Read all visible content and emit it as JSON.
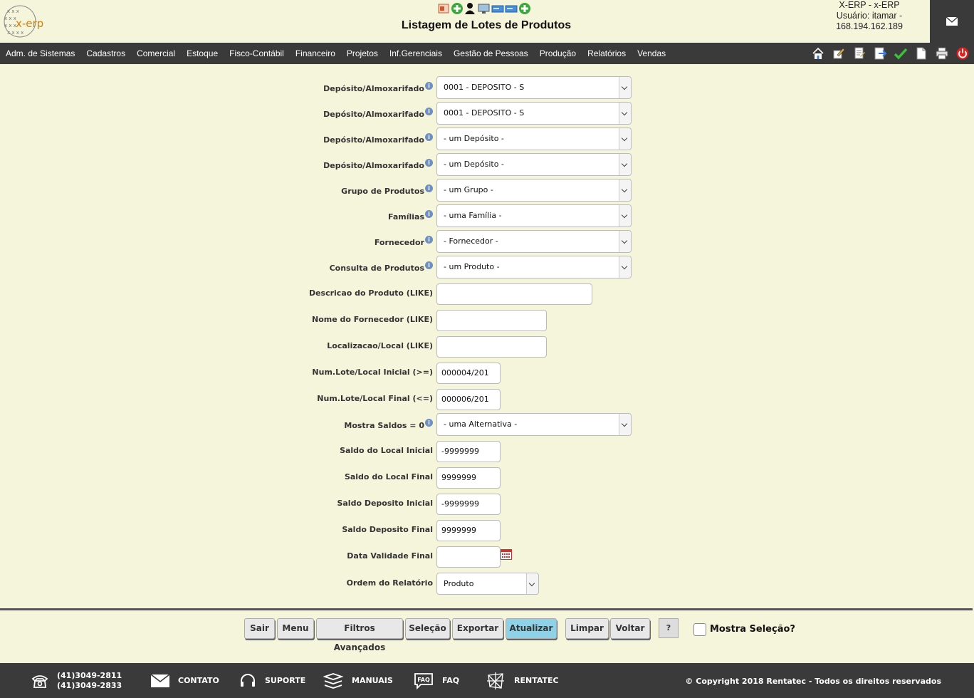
{
  "header": {
    "logo_text": "x-erp",
    "title": "Listagem de Lotes de Produtos",
    "user": {
      "system": "X-ERP - x-ERP",
      "user_line": "Usuário: itamar -",
      "ip": "168.194.162.189"
    },
    "toolbar_icons": [
      "report-icon",
      "add-icon",
      "user-icon",
      "monitor-icon",
      "card-icon",
      "card-icon",
      "add-icon"
    ]
  },
  "nav": {
    "items": [
      "Adm. de Sistemas",
      "Cadastros",
      "Comercial",
      "Estoque",
      "Fisco-Contábil",
      "Financeiro",
      "Projetos",
      "Inf.Gerenciais",
      "Gestão de Pessoas",
      "Produção",
      "Relatórios",
      "Vendas"
    ],
    "icons": [
      "home-icon",
      "edit-icon",
      "notes-icon",
      "export-icon",
      "check-icon",
      "document-icon",
      "print-icon",
      "power-icon"
    ]
  },
  "form": {
    "fields": [
      {
        "label": "Depósito/Almoxarifado",
        "info": "i",
        "value": "0001 - DEPOSITO - S"
      },
      {
        "label": "Depósito/Almoxarifado",
        "info": "i",
        "value": "0001 - DEPOSITO - S"
      },
      {
        "label": "Depósito/Almoxarifado",
        "info": "i",
        "value": "- um Depósito -"
      },
      {
        "label": "Depósito/Almoxarifado",
        "info": "i",
        "value": "- um Depósito -"
      },
      {
        "label": "Grupo de Produtos",
        "info": "i",
        "value": "- um Grupo -"
      },
      {
        "label": "Famílias",
        "info": "i",
        "value": "- uma Família -"
      },
      {
        "label": "Fornecedor",
        "info": "i",
        "value": "- Fornecedor -"
      },
      {
        "label": "Consulta de Produtos",
        "info": "i",
        "value": "- um Produto -"
      },
      {
        "label": "Descricao do Produto (LIKE)",
        "value": ""
      },
      {
        "label": "Nome do Fornecedor (LIKE)",
        "value": ""
      },
      {
        "label": "Localizacao/Local (LIKE)",
        "value": ""
      },
      {
        "label": "Num.Lote/Local Inicial (>=)",
        "value": "000004/201"
      },
      {
        "label": "Num.Lote/Local Final (<=)",
        "value": "000006/201"
      },
      {
        "label": "Mostra Saldos = 0",
        "info": "i",
        "value": "- uma Alternativa -"
      },
      {
        "label": "Saldo do Local Inicial",
        "value": "-9999999"
      },
      {
        "label": "Saldo do Local Final",
        "value": "9999999"
      },
      {
        "label": "Saldo Deposito Inicial",
        "value": "-9999999"
      },
      {
        "label": "Saldo Deposito Final",
        "value": "9999999"
      },
      {
        "label": "Data Validade Final",
        "value": ""
      },
      {
        "label": "Ordem do Relatório",
        "value": "Produto"
      }
    ]
  },
  "buttons": {
    "sair": "Sair",
    "menu": "Menu",
    "filtros": "Filtros Avançados",
    "selecao": "Seleção",
    "exportar": "Exportar",
    "atualizar": "Atualizar",
    "limpar": "Limpar",
    "voltar": "Voltar",
    "help": "?",
    "mostra_selecao": "Mostra Seleção?"
  },
  "footer": {
    "phone1": "(41)3049-2811",
    "phone2": "(41)3049-2833",
    "contato": "CONTATO",
    "suporte": "SUPORTE",
    "manuais": "MANUAIS",
    "faq": "FAQ",
    "faq_icon_text": "FAQ",
    "rentatec": "RENTATEC",
    "copyright": "© Copyright 2018 Rentatec - Todos os direitos reservados"
  },
  "colors": {
    "background": "#f5f5dc",
    "nav": "#3a3a3a",
    "primary_button": "#8fd1e6",
    "logo": "#e07b00"
  }
}
